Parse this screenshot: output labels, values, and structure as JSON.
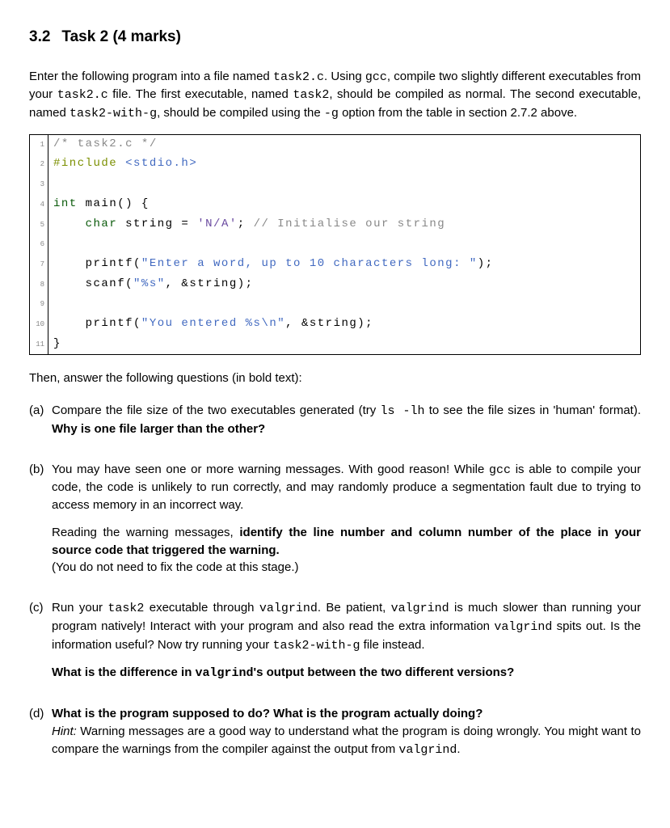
{
  "heading": {
    "number": "3.2",
    "title": "Task 2 (4 marks)"
  },
  "intro": {
    "t1": "Enter the following program into a file named ",
    "c1": "task2.c",
    "t2": ".  Using ",
    "c2": "gcc",
    "t3": ", compile two slightly different executables from your ",
    "c3": "task2.c",
    "t4": " file. The first executable, named ",
    "c4": "task2",
    "t5": ", should be compiled as normal. The second executable, named ",
    "c5": "task2-with-g",
    "t6": ", should be compiled using the ",
    "c6": "-g",
    "t7": " option from the table in section 2.7.2 above."
  },
  "code": {
    "lines": [
      {
        "n": "1",
        "segments": [
          {
            "cls": "c-comment",
            "t": "/* task2.c */"
          }
        ]
      },
      {
        "n": "2",
        "segments": [
          {
            "cls": "c-pp",
            "t": "#include"
          },
          {
            "cls": "",
            "t": " "
          },
          {
            "cls": "c-str",
            "t": "<stdio.h>"
          }
        ]
      },
      {
        "n": "3",
        "segments": [
          {
            "cls": "",
            "t": ""
          }
        ]
      },
      {
        "n": "4",
        "segments": [
          {
            "cls": "c-type",
            "t": "int"
          },
          {
            "cls": "",
            "t": " main() {"
          }
        ]
      },
      {
        "n": "5",
        "segments": [
          {
            "cls": "",
            "t": "    "
          },
          {
            "cls": "c-type",
            "t": "char"
          },
          {
            "cls": "",
            "t": " string = "
          },
          {
            "cls": "c-char",
            "t": "'N/A'"
          },
          {
            "cls": "",
            "t": "; "
          },
          {
            "cls": "c-comment",
            "t": "// Initialise our string"
          }
        ]
      },
      {
        "n": "6",
        "segments": [
          {
            "cls": "",
            "t": ""
          }
        ]
      },
      {
        "n": "7",
        "segments": [
          {
            "cls": "",
            "t": "    printf("
          },
          {
            "cls": "c-str",
            "t": "\"Enter a word, up to 10 characters long: \""
          },
          {
            "cls": "",
            "t": ");"
          }
        ]
      },
      {
        "n": "8",
        "segments": [
          {
            "cls": "",
            "t": "    scanf("
          },
          {
            "cls": "c-str",
            "t": "\"%s\""
          },
          {
            "cls": "",
            "t": ", &string);"
          }
        ]
      },
      {
        "n": "9",
        "segments": [
          {
            "cls": "",
            "t": ""
          }
        ]
      },
      {
        "n": "10",
        "segments": [
          {
            "cls": "",
            "t": "    printf("
          },
          {
            "cls": "c-str",
            "t": "\"You entered %s\\n\""
          },
          {
            "cls": "",
            "t": ", &string);"
          }
        ]
      },
      {
        "n": "11",
        "segments": [
          {
            "cls": "",
            "t": "}"
          }
        ]
      }
    ]
  },
  "after_code": "Then, answer the following questions (in bold text):",
  "qa": {
    "a": {
      "label": "(a)",
      "t1": "Compare the file size of the two executables generated (try ",
      "c1": "ls -lh",
      "t2": " to see the file sizes in 'human' format). ",
      "b1": "Why is one file larger than the other?"
    },
    "b": {
      "label": "(b)",
      "t1": "You may have seen one or more warning messages. With good reason! While ",
      "c1": "gcc",
      "t2": " is able to compile your code, the code is unlikely to run correctly, and may randomly produce a segmentation fault due to trying to access memory in an incorrect way.",
      "t3": "Reading the warning messages, ",
      "b1": "identify the line number and column number of the place in your source code that triggered the warning.",
      "t4": "(You do not need to fix the code at this stage.)"
    },
    "c": {
      "label": "(c)",
      "t1": "Run your ",
      "c1": "task2",
      "t2": " executable through ",
      "c2": "valgrind",
      "t3": ". Be patient, ",
      "c3": "valgrind",
      "t4": " is much slower than running your program natively! Interact with your program and also read the extra information ",
      "c4": "valgrind",
      "t5": " spits out. Is the information useful? Now try running your ",
      "c5": "task2-with-g",
      "t6": " file instead.",
      "b_pre": "What is the difference in ",
      "bc1": "valgrind",
      "b_post": "'s output between the two different versions?"
    },
    "d": {
      "label": "(d)",
      "b1": "What is the program supposed to do? What is the program actually doing?",
      "i1": "Hint:",
      "t1": " Warning messages are a good way to understand what the program is doing wrongly. You might want to compare the warnings from the compiler against the output from ",
      "c1": "valgrind",
      "t2": "."
    }
  }
}
